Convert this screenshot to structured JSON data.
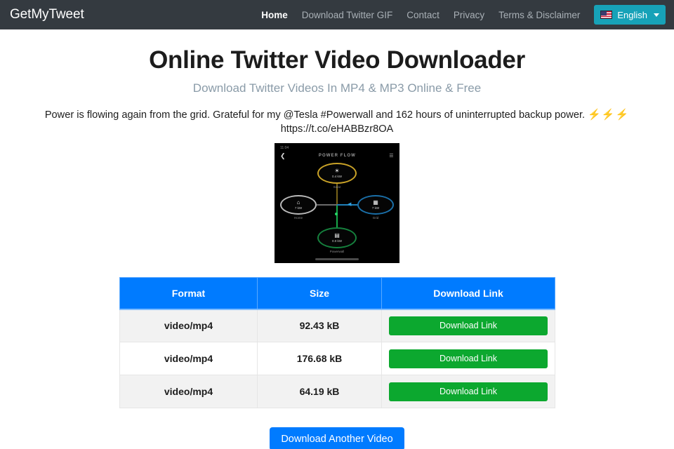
{
  "navbar": {
    "brand": "GetMyTweet",
    "links": [
      {
        "label": "Home",
        "active": true
      },
      {
        "label": "Download Twitter GIF",
        "active": false
      },
      {
        "label": "Contact",
        "active": false
      },
      {
        "label": "Privacy",
        "active": false
      },
      {
        "label": "Terms & Disclaimer",
        "active": false
      }
    ],
    "language_button": {
      "label": "English",
      "flag_icon": "us-flag-icon",
      "caret_icon": "chevron-down-icon",
      "background_color": "#17a2b8"
    },
    "background_color": "#343a40"
  },
  "hero": {
    "title": "Online Twitter Video Downloader",
    "subtitle": "Download Twitter Videos In MP4 & MP3 Online & Free"
  },
  "tweet": {
    "line1": "Power is flowing again from the grid. Grateful for my @Tesla #Powerwall and 162 hours of uninterrupted backup power.",
    "bolts": "⚡⚡⚡",
    "line2": "https://t.co/eHABBzr8OA"
  },
  "video_preview": {
    "status_time": "11:04",
    "status_battery": "",
    "back_icon": "back-chevron-icon",
    "screen_title": "POWER FLOW",
    "menu_icon": "bars-icon",
    "nodes": [
      {
        "name": "solar",
        "label": "Solar",
        "value": "0.4 kW",
        "glyph": "☀",
        "color": "#c9a227"
      },
      {
        "name": "home",
        "label": "Home",
        "value": "7 kW",
        "glyph": "⌂",
        "color": "#b9b9b9"
      },
      {
        "name": "grid",
        "label": "Grid",
        "value": "7 kW",
        "glyph": "▦",
        "color": "#1a6fa8"
      },
      {
        "name": "powerwall",
        "label": "Powerwall",
        "value": "0.0 kW",
        "glyph": "▤",
        "color": "#15803d"
      }
    ]
  },
  "table": {
    "columns": [
      "Format",
      "Size",
      "Download Link"
    ],
    "header_color": "#007bff",
    "link_button_color": "#0ca82f",
    "rows": [
      {
        "format": "video/mp4",
        "size": "92.43 kB",
        "link_label": "Download Link"
      },
      {
        "format": "video/mp4",
        "size": "176.68 kB",
        "link_label": "Download Link"
      },
      {
        "format": "video/mp4",
        "size": "64.19 kB",
        "link_label": "Download Link"
      }
    ]
  },
  "footer": {
    "another_button": "Download Another Video",
    "another_button_color": "#007bff"
  }
}
